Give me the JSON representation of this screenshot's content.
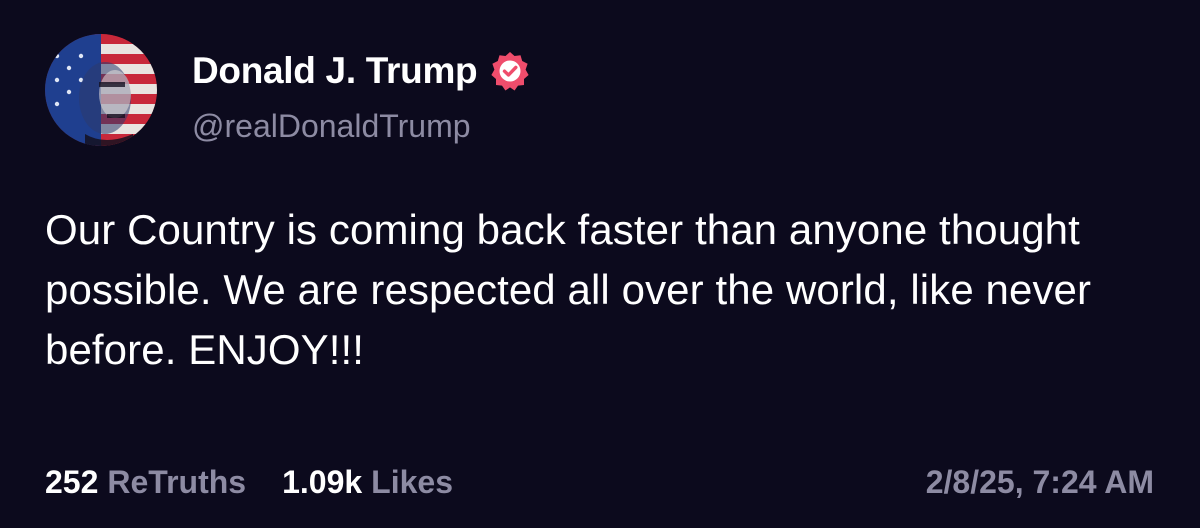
{
  "post": {
    "author": {
      "display_name": "Donald J. Trump",
      "handle": "@realDonaldTrump",
      "verified_icon": "verified-badge-icon",
      "avatar": "profile-avatar"
    },
    "text": "Our Country is coming back faster than anyone thought possible. We are respected all over the world, like never before. ENJOY!!!",
    "stats": {
      "retruths_count": "252",
      "retruths_label": "ReTruths",
      "likes_count": "1.09k",
      "likes_label": "Likes"
    },
    "timestamp": "2/8/25, 7:24 AM"
  },
  "colors": {
    "background": "#0c0a1d",
    "primary_text": "#ffffff",
    "secondary_text": "#8d8ba3",
    "verified_badge": "#ef4d6c"
  }
}
